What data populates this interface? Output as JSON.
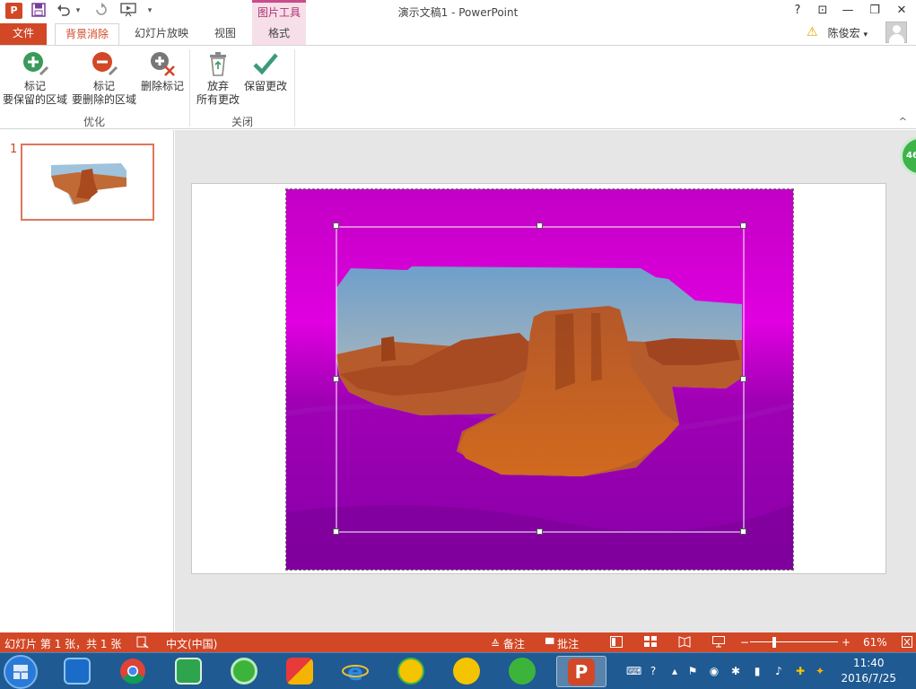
{
  "window": {
    "doc_title": "演示文稿1 - PowerPoint",
    "app_logo": "P",
    "contextual_tab_group": "图片工具",
    "help": "?",
    "ribbon_display": "⊡",
    "minimize": "—",
    "restore": "❐",
    "close": "✕"
  },
  "quick_access": {
    "save_icon": "save-icon",
    "undo_icon": "undo-icon",
    "redo_icon": "redo-icon",
    "start_slideshow_icon": "start-slideshow-icon",
    "customize_icon": "dropdown-icon"
  },
  "tabs": {
    "file": "文件",
    "background_removal": "背景消除",
    "slideshow": "幻灯片放映",
    "view": "视图",
    "format": "格式"
  },
  "user": {
    "name": "陈俊宏",
    "caret": "▾"
  },
  "ribbon": {
    "mark_keep": {
      "line1": "标记",
      "line2": "要保留的区域"
    },
    "mark_remove": {
      "line1": "标记",
      "line2": "要删除的区域"
    },
    "delete_mark": {
      "line1": "删除标记"
    },
    "discard": {
      "line1": "放弃",
      "line2": "所有更改"
    },
    "keep": {
      "line1": "保留更改"
    },
    "group_refine": "优化",
    "group_close": "关闭",
    "collapse": "^"
  },
  "thumbnails": {
    "slide_number": "1"
  },
  "badge": "46",
  "status": {
    "slide_info": "幻灯片 第 1 张，共 1 张",
    "language": "中文(中国)",
    "notes": "备注",
    "comments": "批注",
    "zoom": "61%",
    "zoom_level": 0.61
  },
  "clock": {
    "time": "11:40",
    "date": "2016/7/25"
  },
  "colors": {
    "accent": "#d24726",
    "magenta_mask": "#b000c0",
    "taskbar": "#1f5a92"
  }
}
